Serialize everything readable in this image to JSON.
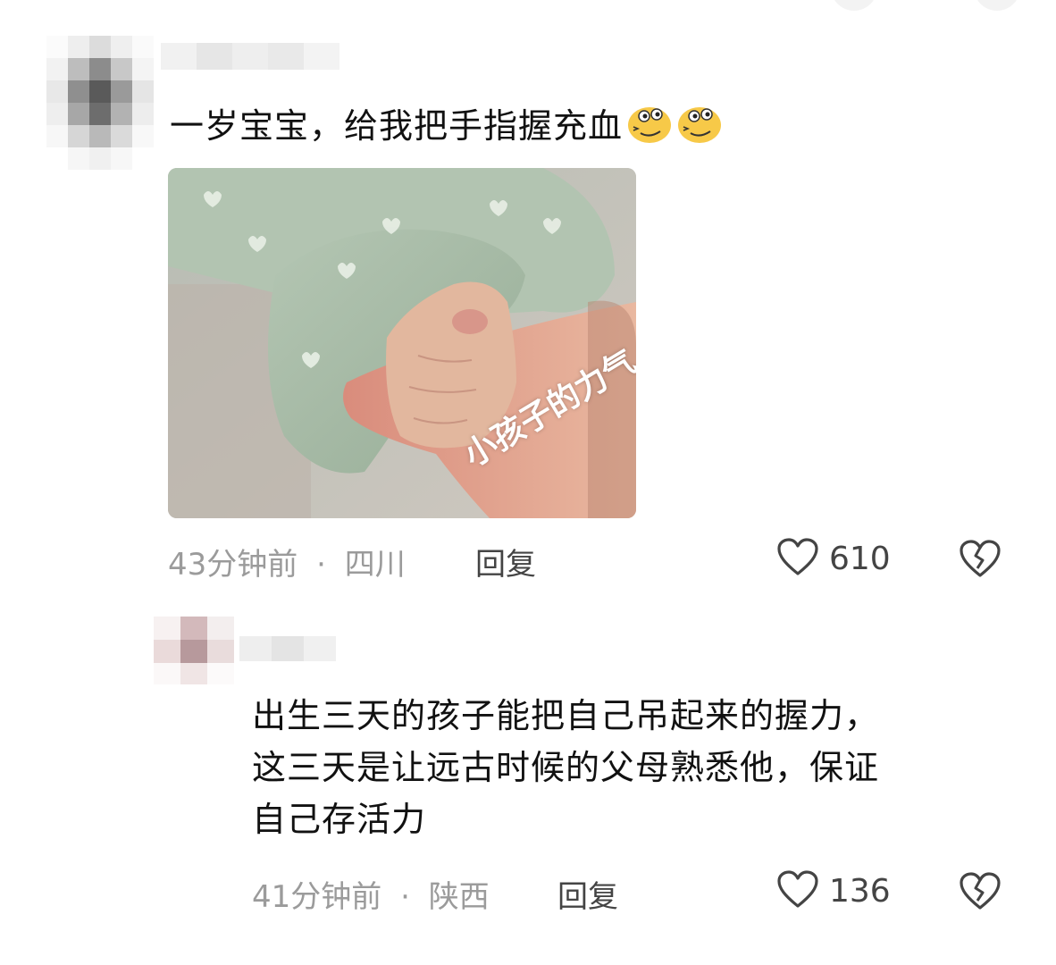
{
  "comments": [
    {
      "text": "一岁宝宝，给我把手指握充血",
      "emoji_count": 2,
      "photo_caption": "小孩子的力气",
      "time": "43分钟前",
      "location": "四川",
      "reply_label": "回复",
      "likes": "610"
    },
    {
      "text_lines": [
        "出生三天的孩子能把自己吊起来的握力，",
        "这三天是让远古时候的父母熟悉他，保证",
        "自己存活力"
      ],
      "time": "41分钟前",
      "location": "陕西",
      "reply_label": "回复",
      "likes": "136"
    }
  ],
  "separator": "·",
  "icons": {
    "like": "heart-outline-icon",
    "dislike": "broken-heart-icon",
    "emoji": "smirk-face-emoji-icon"
  },
  "colors": {
    "meta_gray": "#9b9b9b",
    "text": "#111111",
    "emoji_yellow": "#f7c948"
  }
}
